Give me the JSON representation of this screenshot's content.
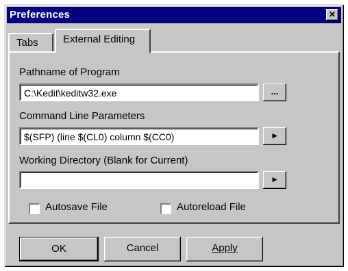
{
  "window": {
    "title": "Preferences",
    "close_glyph": "✕"
  },
  "tabs": [
    {
      "label": "Tabs"
    },
    {
      "label": "External Editing"
    }
  ],
  "fields": {
    "program": {
      "label": "Pathname of Program",
      "value": "C:\\Kedit\\keditw32.exe",
      "button_label": "..."
    },
    "params": {
      "label": "Command Line Parameters",
      "value": "$(SFP) (line $(CL0) column $(CC0)",
      "button_label": "▸"
    },
    "workdir": {
      "label": "Working Directory (Blank for Current)",
      "value": "",
      "button_label": "▸"
    }
  },
  "checkboxes": {
    "autosave": {
      "label": "Autosave File",
      "checked": false
    },
    "autoreload": {
      "label": "Autoreload File",
      "checked": false
    }
  },
  "buttons": {
    "ok": "OK",
    "cancel": "Cancel",
    "apply": "Apply"
  }
}
